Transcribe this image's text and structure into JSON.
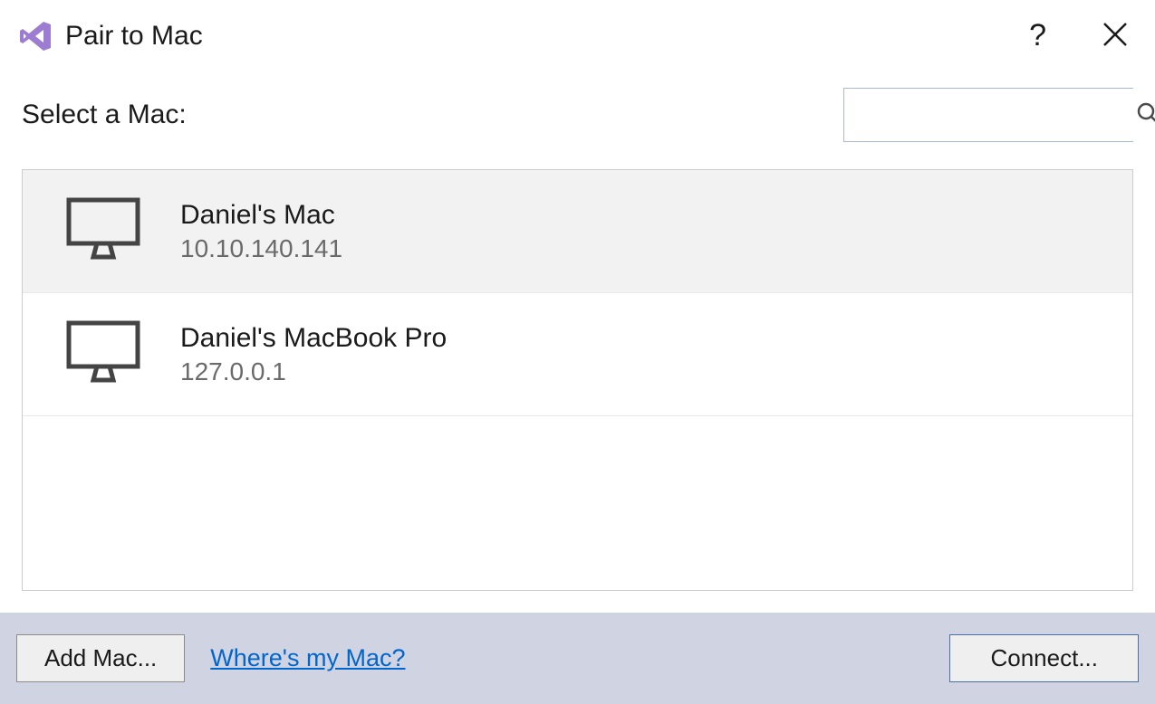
{
  "titlebar": {
    "title": "Pair to Mac"
  },
  "content": {
    "selectLabel": "Select a Mac:",
    "search": {
      "value": "",
      "placeholder": ""
    }
  },
  "macs": [
    {
      "name": "Daniel's Mac",
      "ip": "10.10.140.141",
      "selected": true
    },
    {
      "name": "Daniel's MacBook Pro",
      "ip": "127.0.0.1",
      "selected": false
    }
  ],
  "footer": {
    "addMacLabel": "Add Mac...",
    "whereLinkLabel": "Where's my Mac?",
    "connectLabel": "Connect..."
  }
}
